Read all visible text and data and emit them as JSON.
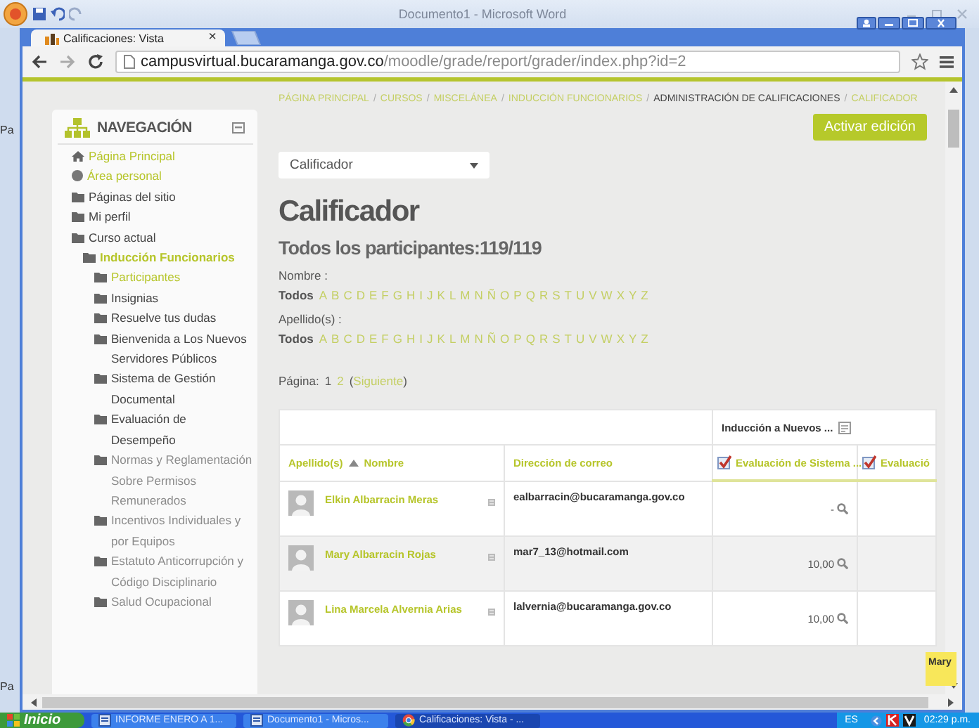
{
  "word_window": {
    "title": "Documento1 - Microsoft Word",
    "margin_labels": [
      "Pa",
      "Pa"
    ]
  },
  "browser": {
    "tab": {
      "title": "Calificaciones: Vista",
      "close": "×"
    },
    "url": {
      "host": "campusvirtual.bucaramanga.gov.co",
      "path": "/moodle/grade/report/grader/index.php?id=2"
    }
  },
  "sidebar": {
    "title": "NAVEGACIÓN",
    "items": [
      {
        "label": "Página Principal",
        "kind": "home",
        "link": true,
        "current": false,
        "dimmed": false
      },
      {
        "label": "Área personal",
        "kind": "dot",
        "link": true,
        "current": false,
        "dimmed": false
      },
      {
        "label": "Páginas del sitio",
        "kind": "folder",
        "link": false,
        "current": false,
        "dimmed": false
      },
      {
        "label": "Mi perfil",
        "kind": "folder",
        "link": false,
        "current": false,
        "dimmed": false
      },
      {
        "label": "Curso actual",
        "kind": "folder",
        "link": false,
        "current": false,
        "dimmed": false,
        "children": [
          {
            "label": "Inducción Funcionarios",
            "kind": "folder",
            "link": true,
            "current": true,
            "dimmed": false,
            "children": [
              {
                "label": "Participantes",
                "kind": "folder",
                "link": true,
                "current": false,
                "dimmed": false
              },
              {
                "label": "Insignias",
                "kind": "folder",
                "link": false,
                "current": false,
                "dimmed": false
              },
              {
                "label": "Resuelve tus dudas",
                "kind": "folder",
                "link": false,
                "current": false,
                "dimmed": false
              },
              {
                "label": "Bienvenida a Los Nuevos Servidores Públicos",
                "kind": "folder",
                "link": false,
                "current": false,
                "dimmed": false
              },
              {
                "label": "Sistema de Gestión Documental",
                "kind": "folder",
                "link": false,
                "current": false,
                "dimmed": false
              },
              {
                "label": "Evaluación de Desempeño",
                "kind": "folder",
                "link": false,
                "current": false,
                "dimmed": false
              },
              {
                "label": "Normas y Reglamentación Sobre Permisos Remunerados",
                "kind": "folder",
                "link": false,
                "current": false,
                "dimmed": true
              },
              {
                "label": "Incentivos Individuales y por Equipos",
                "kind": "folder",
                "link": false,
                "current": false,
                "dimmed": true
              },
              {
                "label": "Estatuto Anticorrupción y Código Disciplinario",
                "kind": "folder",
                "link": false,
                "current": false,
                "dimmed": true
              },
              {
                "label": "Salud Ocupacional",
                "kind": "folder",
                "link": false,
                "current": false,
                "dimmed": true
              }
            ]
          }
        ]
      }
    ]
  },
  "breadcrumb": {
    "separator": "/",
    "items": [
      {
        "label": "PÁGINA PRINCIPAL",
        "link": true
      },
      {
        "label": "CURSOS",
        "link": true
      },
      {
        "label": "MISCELÁNEA",
        "link": true
      },
      {
        "label": "INDUCCIÓN FUNCIONARIOS",
        "link": true
      },
      {
        "label": "ADMINISTRACIÓN DE CALIFICACIONES",
        "link": false
      },
      {
        "label": "CALIFICADOR",
        "link": true
      }
    ]
  },
  "edit_button": "Activar edición",
  "report_select": {
    "value": "Calificador"
  },
  "heading": "Calificador",
  "subheading": "Todos los participantes:119/119",
  "filters": [
    {
      "label": "Nombre :",
      "all": "Todos",
      "letters": [
        "A",
        "B",
        "C",
        "D",
        "E",
        "F",
        "G",
        "H",
        "I",
        "J",
        "K",
        "L",
        "M",
        "N",
        "Ñ",
        "O",
        "P",
        "Q",
        "R",
        "S",
        "T",
        "U",
        "V",
        "W",
        "X",
        "Y",
        "Z"
      ]
    },
    {
      "label": "Apellido(s) :",
      "all": "Todos",
      "letters": [
        "A",
        "B",
        "C",
        "D",
        "E",
        "F",
        "G",
        "H",
        "I",
        "J",
        "K",
        "L",
        "M",
        "N",
        "Ñ",
        "O",
        "P",
        "Q",
        "R",
        "S",
        "T",
        "U",
        "V",
        "W",
        "X",
        "Y",
        "Z"
      ]
    }
  ],
  "pagination": {
    "label": "Página:",
    "pages": [
      {
        "label": "1",
        "selected": true
      },
      {
        "label": "2",
        "selected": false
      }
    ],
    "next_open": "(",
    "next": "Siguiente",
    "next_close": ")"
  },
  "grader_table": {
    "category": "Inducción a Nuevos ...",
    "surname_header": "Apellido(s)",
    "name_header": "Nombre",
    "email_header": "Dirección de correo",
    "items": [
      "Evaluación de Sistema ...",
      "Evaluació"
    ],
    "rows": [
      {
        "name": "Elkin Albarracin Meras",
        "email": "ealbarracin@bucaramanga.gov.co",
        "grade": "-"
      },
      {
        "name": "Mary Albarracin Rojas",
        "email": "mar7_13@hotmail.com",
        "grade": "10,00"
      },
      {
        "name": "Lina Marcela Alvernia Arias",
        "email": "lalvernia@bucaramanga.gov.co",
        "grade": "10,00"
      }
    ]
  },
  "tooltip": "Mary",
  "taskbar": {
    "start": "Inicio",
    "tasks": [
      {
        "label": "INFORME ENERO A 1...",
        "kind": "word",
        "selected": false
      },
      {
        "label": "Documento1 - Micros...",
        "kind": "word",
        "selected": false
      },
      {
        "label": "Calificaciones: Vista - ...",
        "kind": "chrome",
        "selected": true
      }
    ],
    "language": "ES",
    "clock": "02:29 p.m."
  }
}
